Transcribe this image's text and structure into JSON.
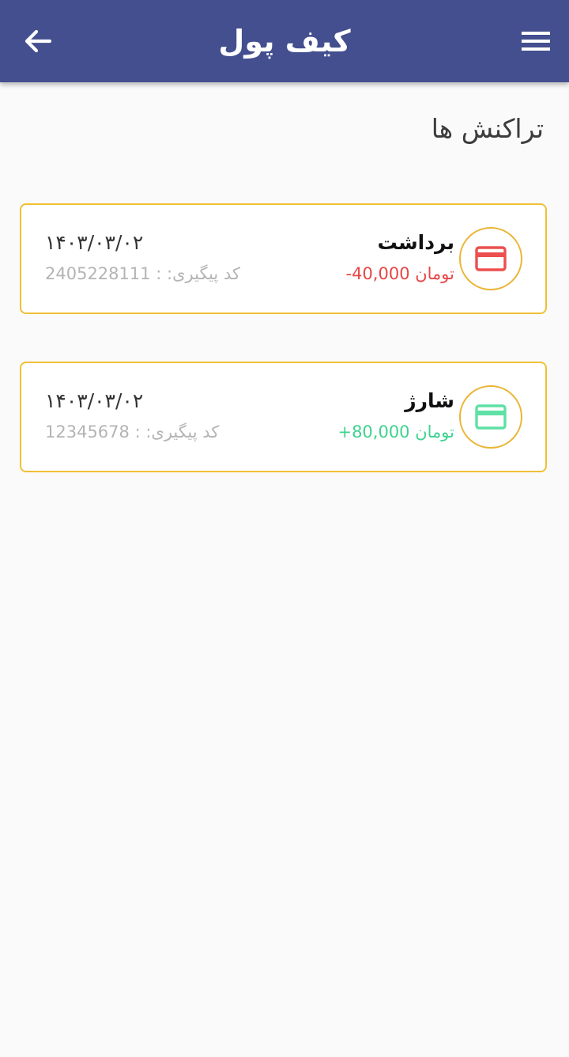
{
  "header": {
    "title": "کیف پول",
    "back_icon": "arrow-left-icon",
    "menu_icon": "hamburger-menu-icon",
    "background_color": "#444f8f"
  },
  "section": {
    "title": "تراکنش ها"
  },
  "transactions": [
    {
      "type": "برداشت",
      "amount": "-40,000 تومان",
      "amount_color": "#e84545",
      "icon": "credit-card-icon",
      "icon_color": "#ec4f4f",
      "date": "۱۴۰۳/۰۳/۰۲",
      "tracking_label": "کد پیگیری: :",
      "tracking_code": "2405228111"
    },
    {
      "type": "شارژ",
      "amount": "+80,000 تومان",
      "amount_color": "#3ed38f",
      "icon": "credit-card-icon",
      "icon_color": "#5fe0a4",
      "date": "۱۴۰۳/۰۳/۰۲",
      "tracking_label": "کد پیگیری: :",
      "tracking_code": "12345678"
    }
  ],
  "colors": {
    "card_border": "#f0c035",
    "page_background": "#fafafa"
  }
}
